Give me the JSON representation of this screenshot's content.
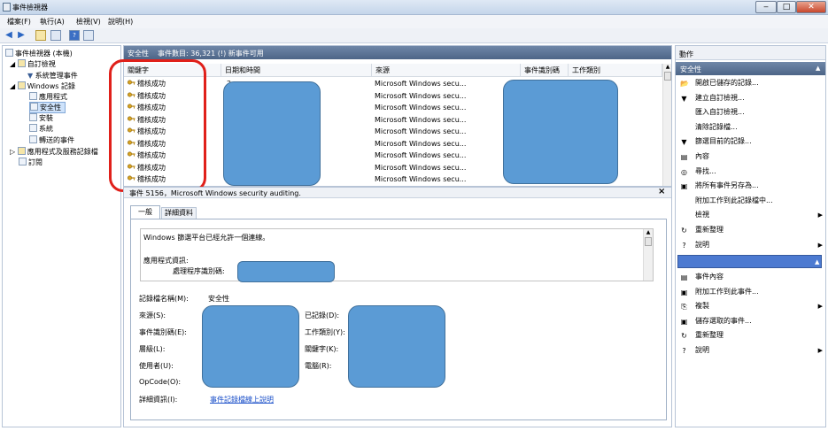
{
  "window": {
    "title": "事件檢視器",
    "minimize": "‒",
    "maximize": "□",
    "close": "✕"
  },
  "menu": {
    "file": "檔案(F)",
    "action": "執行(A)",
    "view": "檢視(V)",
    "help": "說明(H)"
  },
  "toolbar": {
    "back": "◀",
    "forward": "▶",
    "help_box": "?"
  },
  "tree": {
    "root": "事件檢視器 (本機)",
    "custom_views": "自訂檢視",
    "admin_events": "系統管理事件",
    "windows_logs": "Windows 記錄",
    "application": "應用程式",
    "security": "安全性",
    "setup": "安裝",
    "system": "系統",
    "forwarded": "轉送的事件",
    "apps_services": "應用程式及服務記錄檔",
    "subscriptions": "訂閱"
  },
  "list": {
    "header_title": "安全性",
    "header_count": "事件數目: 36,321 (!) 新事件可用",
    "columns": {
      "keyword": "關鍵字",
      "datetime": "日期和時間",
      "source": "來源",
      "event_id": "事件識別碼",
      "task": "工作類別"
    },
    "rows": [
      {
        "keyword": "稽核成功",
        "datetime": "2",
        "source": "Microsoft Windows secu..."
      },
      {
        "keyword": "稽核成功",
        "datetime": "",
        "source": "Microsoft Windows secu..."
      },
      {
        "keyword": "稽核成功",
        "datetime": "",
        "source": "Microsoft Windows secu..."
      },
      {
        "keyword": "稽核成功",
        "datetime": "",
        "source": "Microsoft Windows secu..."
      },
      {
        "keyword": "稽核成功",
        "datetime": "",
        "source": "Microsoft Windows secu..."
      },
      {
        "keyword": "稽核成功",
        "datetime": "",
        "source": "Microsoft Windows secu..."
      },
      {
        "keyword": "稽核成功",
        "datetime": "",
        "source": "Microsoft Windows secu..."
      },
      {
        "keyword": "稽核成功",
        "datetime": "",
        "source": "Microsoft Windows secu..."
      },
      {
        "keyword": "稽核成功",
        "datetime": "",
        "source": "Microsoft Windows secu..."
      }
    ]
  },
  "detail": {
    "title": "事件 5156，Microsoft Windows security auditing.",
    "close": "×",
    "tab_general": "一般",
    "tab_details": "詳細資料",
    "message_line1": "Windows 篩選平台已經允許一個連線。",
    "message_line2": "應用程式資訊:",
    "message_line3": "處理程序識別碼:",
    "fields": {
      "log_name_label": "記錄檔名稱(M):",
      "log_name_value": "安全性",
      "source_label": "來源(S):",
      "logged_label": "已記錄(D):",
      "event_id_label": "事件識別碼(E):",
      "task_label": "工作類別(Y):",
      "level_label": "層級(L):",
      "keywords_label": "關鍵字(K):",
      "user_label": "使用者(U):",
      "computer_label": "電腦(R):",
      "opcode_label": "OpCode(O):",
      "more_info_label": "詳細資訊(I):",
      "more_info_link": "事件記錄檔線上說明"
    }
  },
  "actions": {
    "title": "動作",
    "section1": "安全性",
    "items1": [
      {
        "label": "開啟已儲存的記錄...",
        "icon": "📂",
        "arrow": ""
      },
      {
        "label": "建立自訂檢視...",
        "icon": "▼",
        "arrow": ""
      },
      {
        "label": "匯入自訂檢視...",
        "icon": "",
        "arrow": ""
      },
      {
        "label": "清除記錄檔...",
        "icon": "",
        "arrow": ""
      },
      {
        "label": "篩選目前的記錄...",
        "icon": "▼",
        "arrow": ""
      },
      {
        "label": "內容",
        "icon": "▤",
        "arrow": ""
      },
      {
        "label": "尋找...",
        "icon": "◎",
        "arrow": ""
      },
      {
        "label": "將所有事件另存為...",
        "icon": "▣",
        "arrow": ""
      },
      {
        "label": "附加工作到此記錄檔中...",
        "icon": "",
        "arrow": ""
      },
      {
        "label": "檢視",
        "icon": "",
        "arrow": "▶"
      },
      {
        "label": "重新整理",
        "icon": "↻",
        "arrow": ""
      },
      {
        "label": "說明",
        "icon": "?",
        "arrow": "▶"
      }
    ],
    "items2": [
      {
        "label": "事件內容",
        "icon": "▤",
        "arrow": ""
      },
      {
        "label": "附加工作到此事件...",
        "icon": "▣",
        "arrow": ""
      },
      {
        "label": "複製",
        "icon": "⎘",
        "arrow": "▶"
      },
      {
        "label": "儲存選取的事件...",
        "icon": "▣",
        "arrow": ""
      },
      {
        "label": "重新整理",
        "icon": "↻",
        "arrow": ""
      },
      {
        "label": "說明",
        "icon": "?",
        "arrow": "▶"
      }
    ]
  },
  "colors": {
    "redaction": "#5b9bd5",
    "annotation_red": "#e0201a",
    "header_blue": "#5b7396"
  }
}
